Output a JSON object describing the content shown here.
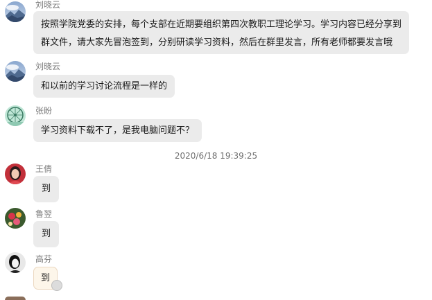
{
  "messages": [
    {
      "sender": "刘晓云",
      "avatar": "landscape-avatar-icon",
      "lines": [
        "按照学院党委的安排，每个支部在近期要组织第四次教职工理论学习。学习内容已经分享到",
        "群文件，请大家先冒泡签到，分别研读学习资料，然后在群里发言，所有老师都要发言哦"
      ]
    },
    {
      "sender": "刘晓云",
      "avatar": "landscape-avatar-icon",
      "text": "和以前的学习讨论流程是一样的"
    },
    {
      "sender": "张盼",
      "avatar": "ferris-wheel-avatar-icon",
      "text": "学习资料下载不了，是我电脑问题不？"
    }
  ],
  "timestamp": "2020/6/18 19:39:25",
  "messages_after": [
    {
      "sender": "王倩",
      "avatar": "woman-portrait-avatar-icon",
      "text": "到"
    },
    {
      "sender": "鲁翌",
      "avatar": "flower-avatar-icon",
      "text": "到"
    },
    {
      "sender": "高芬",
      "avatar": "portrait-sketch-avatar-icon",
      "text": "到",
      "bubble_style": "special"
    }
  ]
}
